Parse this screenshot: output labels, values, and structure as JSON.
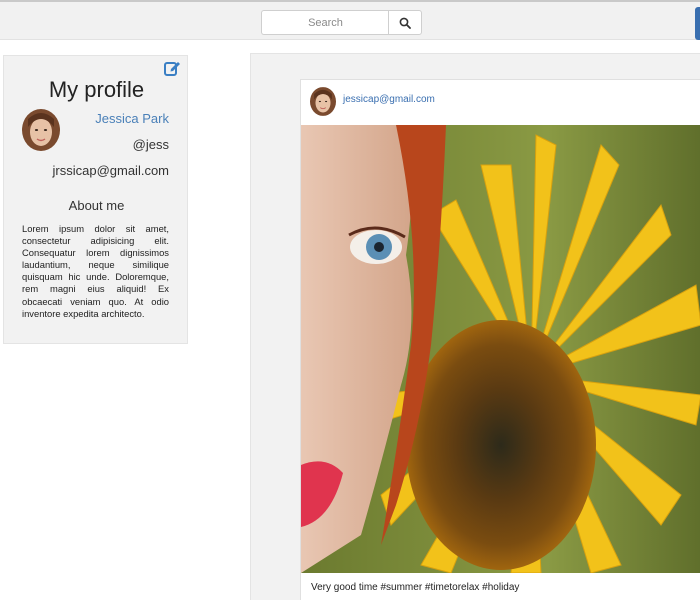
{
  "search": {
    "placeholder": "Search",
    "icon": "search-icon"
  },
  "colors": {
    "accent": "#3a6fb0",
    "link": "#4a80b8",
    "panel": "#f2f2f2"
  },
  "profile": {
    "title": "My profile",
    "name": "Jessica Park",
    "handle": "@jess",
    "email": "jrssicap@gmail.com",
    "edit_icon": "edit-icon",
    "about_heading": "About me",
    "about_text": "Lorem ipsum dolor sit amet, consectetur adipisicing elit. Consequatur lorem dignissimos laudantium, neque similique quisquam hic unde. Doloremque, rem magni eius aliquid! Ex obcaecati veniam quo. At odio inventore expedita architecto."
  },
  "post": {
    "author": "jessicap@gmail.com",
    "caption": "Very good time #summer #timetorelax #holiday"
  }
}
